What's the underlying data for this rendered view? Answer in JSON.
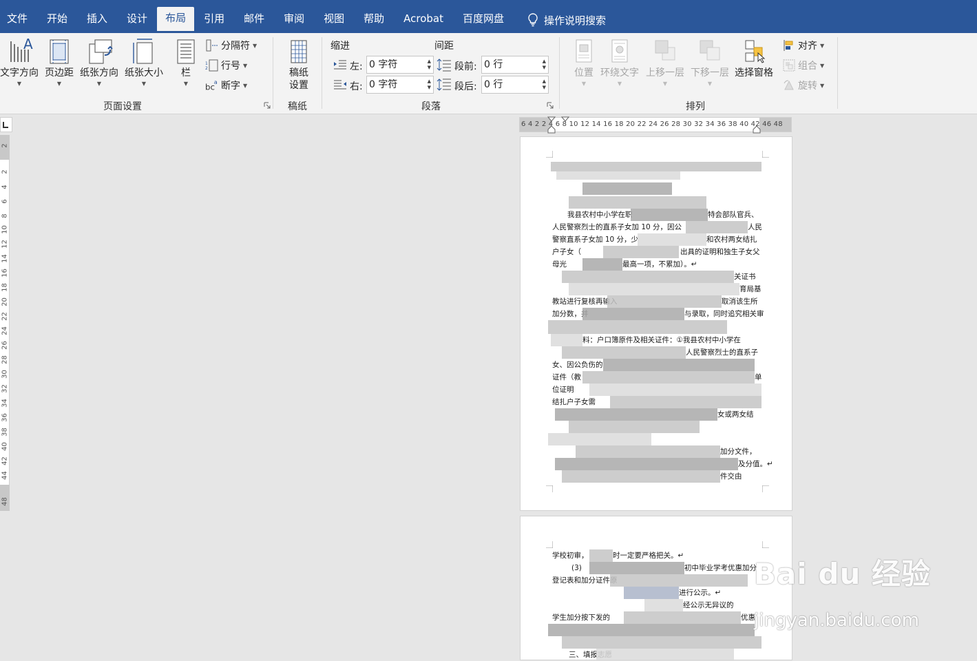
{
  "tabs": [
    "文件",
    "开始",
    "插入",
    "设计",
    "布局",
    "引用",
    "邮件",
    "审阅",
    "视图",
    "帮助",
    "Acrobat",
    "百度网盘"
  ],
  "active_tab": "布局",
  "tell_me": "操作说明搜索",
  "page_setup": {
    "label": "页面设置",
    "text_direction": "文字方向",
    "margins": "页边距",
    "orientation": "纸张方向",
    "size": "纸张大小",
    "columns": "栏",
    "breaks": "分隔符",
    "line_numbers": "行号",
    "hyphenation": "断字"
  },
  "manuscript": {
    "label": "稿纸",
    "btn_line1": "稿纸",
    "btn_line2": "设置"
  },
  "paragraph": {
    "label": "段落",
    "indent_title": "缩进",
    "spacing_title": "间距",
    "left_label": "左:",
    "right_label": "右:",
    "left_value": "0 字符",
    "right_value": "0 字符",
    "before_label": "段前:",
    "after_label": "段后:",
    "before_value": "0 行",
    "after_value": "0 行"
  },
  "arrange": {
    "label": "排列",
    "position": "位置",
    "wrap_text": "环绕文字",
    "bring_forward": "上移一层",
    "send_backward": "下移一层",
    "selection_pane": "选择窗格",
    "align": "对齐",
    "group": "组合",
    "rotate": "旋转"
  },
  "ruler": {
    "h_numbers": "6 4 2  2 4 6 8 10 12 14 16 18 20 22 24 26 28 30 32 34 36 38 40 42  46 48",
    "v_numbers": [
      "2",
      "2",
      "4",
      "6",
      "8",
      "10",
      "12",
      "14",
      "16",
      "18",
      "20",
      "22",
      "24",
      "26",
      "28",
      "30",
      "32",
      "34",
      "36",
      "38",
      "40",
      "42",
      "44",
      "48"
    ]
  },
  "page1_lines": [
    "我县农村中小学在职",
    "特会部队官兵、",
    "人民警察烈士的直系子女加 10 分，因公",
    "人民",
    "警察直系子女加 10 分，少",
    "和农村两女结扎",
    "户子女（",
    "出具的证明和独生子女父",
    "母光",
    "最高一项，不累加）。↵",
    "关证书",
    "育局基",
    "教站进行复核再输入",
    "取消该生所",
    "加分数，并",
    "与录取，同时追究相关审",
    "料：户口簿原件及相关证件：①我县农村中小学在",
    "人民警察烈士的直系子",
    "女、因公负伤的",
    "证件（教",
    "单",
    "位证明",
    "结扎户子女需",
    "女或两女结",
    "加分文件，",
    "及分值。↵",
    "件交由"
  ],
  "page2_lines": [
    "学校初审，",
    "时一定要严格把关。↵",
    "(3)",
    "初中毕业学考优惠加分",
    "登记表和加分证件原",
    "进行公示。↵",
    "经公示无异议的",
    "学生加分按下发的",
    "优惠",
    "三、填报志愿"
  ],
  "watermark": {
    "brand": "Bai du 经验",
    "url": "jingyan.baidu.com"
  }
}
